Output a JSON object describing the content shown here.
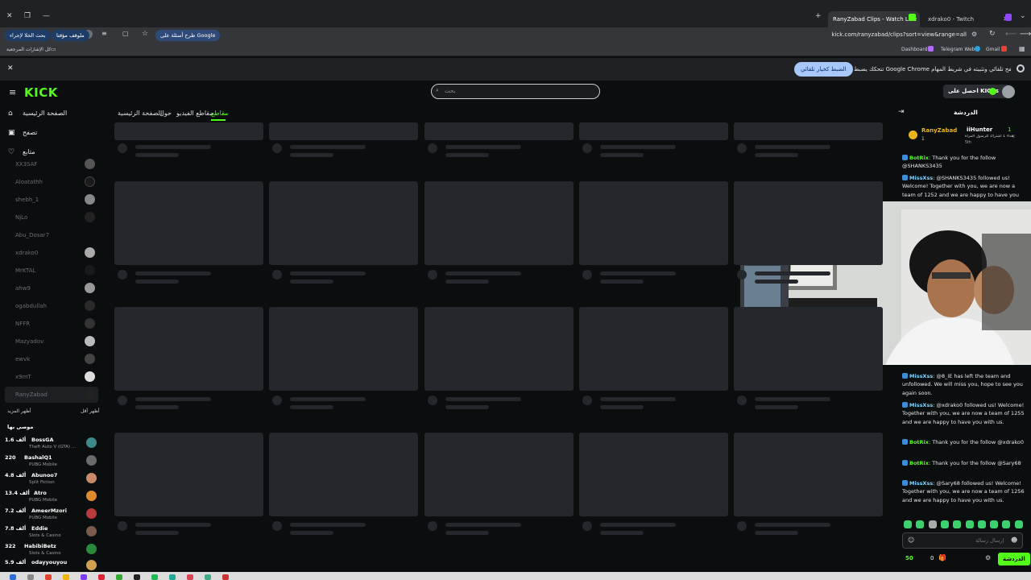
{
  "browser": {
    "tabs": [
      {
        "label": "RanyZabad Clips - Watch Live"
      },
      {
        "label": "xdrako0 - Twitch"
      }
    ],
    "new_tab": "+",
    "url": "kick.com/ranyzabad/clips?sort=view&range=all",
    "toolbar_chips": [
      "بحث الخلا لإجراء",
      "ملوقف مؤقتا",
      "طرح أسئلة على Google"
    ],
    "bookmarks_left": "كل الإشارات المرجعية",
    "bookmarks_right": [
      "Dashboard",
      "Telegram Web",
      "Gmail"
    ],
    "infobar": {
      "text": "تتحكك يضبط Google Chrome كمتصفح تلقائي وتثبيته في شريط المهام",
      "button": "الضبط كخيار تلقائي"
    }
  },
  "kick": {
    "logo": "KICK",
    "search_placeholder": "بحث",
    "get_kicks": "احصل على KICKs"
  },
  "sidebar": {
    "nav": [
      {
        "label": "الصفحة الرئيسية",
        "icon": "home-icon"
      },
      {
        "label": "تصفح",
        "icon": "browse-icon"
      },
      {
        "label": "متابع",
        "icon": "heart-icon"
      }
    ],
    "following": [
      "XX3SAF",
      "Aloatathh",
      "shebh_1",
      "NjLo",
      "Abu_Dosar7",
      "xdrako0",
      "MrKTAL",
      "ahw9",
      "ogabdullah",
      "NFFR",
      "Mazyadov",
      "ewvk",
      "x9mT",
      "RanyZabad"
    ],
    "show_more": "أظهر المزيد",
    "show_less": "أظهر أقل",
    "recommended_title": "موصى بها",
    "recommended": [
      {
        "viewers": "1.6 ألف",
        "name": "BossGA",
        "game": "Theft Auto V (GTA) ...",
        "avatar_color": "#3d8a8a"
      },
      {
        "viewers": "220",
        "name": "BashalQ1",
        "game": "PUBG Mobile",
        "avatar_color": "#6a6a6a"
      },
      {
        "viewers": "4.8 ألف",
        "name": "Abunoo7",
        "game": "Split Fiction",
        "avatar_color": "#c98a6a"
      },
      {
        "viewers": "13.4 ألف",
        "name": "Atro",
        "game": "PUBG Mobile",
        "avatar_color": "#e08a30"
      },
      {
        "viewers": "7.2 ألف",
        "name": "AmeerMzori",
        "game": "PUBG Mobile",
        "avatar_color": "#b83a3a"
      },
      {
        "viewers": "7.8 ألف",
        "name": "Eddie",
        "game": "Slots & Casino",
        "avatar_color": "#7a5a4a"
      },
      {
        "viewers": "322",
        "name": "HabibiBetz",
        "game": "Slots & Casino",
        "avatar_color": "#2a8a3a"
      },
      {
        "viewers": "5.9 ألف",
        "name": "odayyouyou",
        "game": "",
        "avatar_color": "#d0a050"
      }
    ]
  },
  "main": {
    "tabs": [
      {
        "label": "مقاطع",
        "active": true
      },
      {
        "label": "مقاطع الفيديو",
        "active": false
      },
      {
        "label": "حول",
        "active": false
      },
      {
        "label": "الصفحة الرئيسية",
        "active": false
      }
    ]
  },
  "chat": {
    "title": "الدردشة",
    "pinned": {
      "streamer": "RanyZabad",
      "streamer_count": "1",
      "user": "iiHunter",
      "user_count": "1",
      "subtext": "إهداء 1 اشتراك للرسول المرأة",
      "sub2": "5th"
    },
    "messages": [
      {
        "user": "BotRix",
        "text": "Thank you for the follow @SHANKS3435"
      },
      {
        "user": "MissXss",
        "text": "@SHANKS3435 followed us! Welcome! Together with you, we are now a team of 1252 and we are happy to have you"
      },
      {
        "user": "MissXss",
        "text": "@8_iE has left the team and unfollowed. We will miss you, hope to see you again soon."
      },
      {
        "user": "MissXss",
        "text": "@xdrako0 followed us! Welcome! Together with you, we are now a team of 1255 and we are happy to have you with us."
      },
      {
        "user": "BotRix",
        "text": "Thank you for the follow @xdrako0"
      },
      {
        "user": "BotRix",
        "text": "Thank you for the follow @Sary68"
      },
      {
        "user": "MissXss",
        "text": "@Sary68 followed us! Welcome! Together with you, we are now a team of 1256 and we are happy to have you with us."
      }
    ],
    "input_placeholder": "إرسال رسالة",
    "kicks_count": "50",
    "points": "0",
    "send_button": "الدردشة"
  },
  "colors": {
    "accent": "#53fc18",
    "bg": "#0b0e0f",
    "card": "#24272c"
  }
}
